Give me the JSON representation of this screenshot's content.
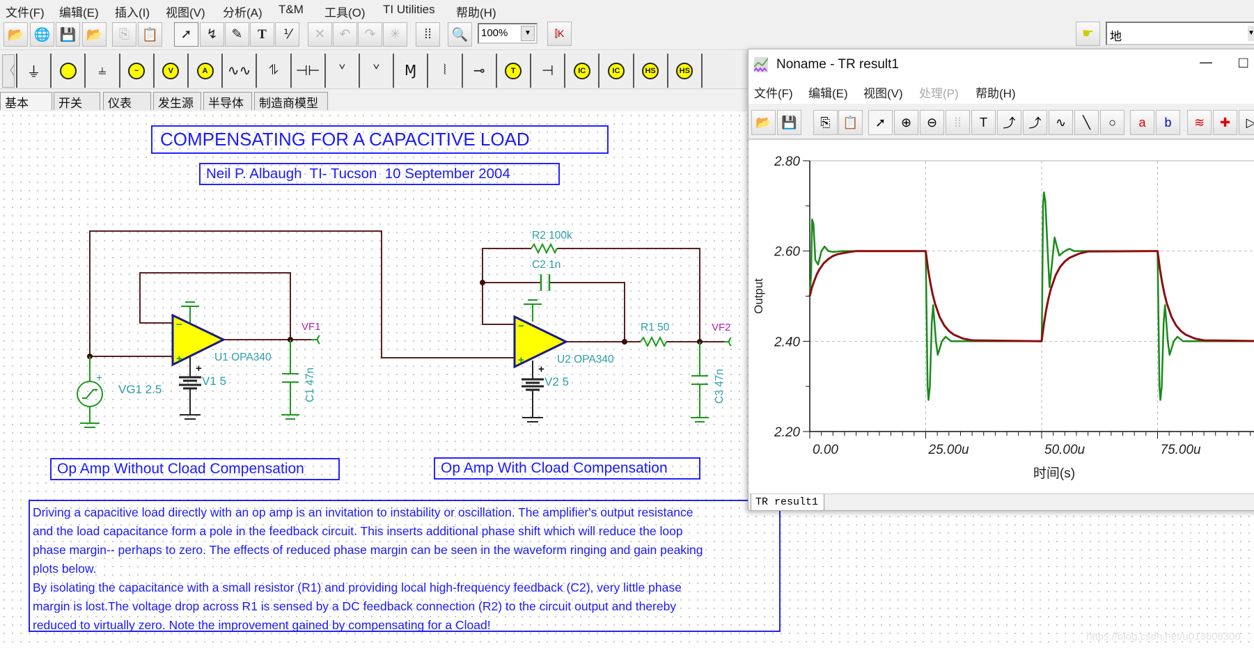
{
  "main_menu": [
    "文件(F)",
    "编辑(E)",
    "插入(I)",
    "视图(V)",
    "分析(A)",
    "T&M",
    "工具(O)",
    "TI Utilities",
    "帮助(H)"
  ],
  "toolbar": {
    "buttons": [
      {
        "icon": "open-folder-icon",
        "enabled": true
      },
      {
        "icon": "web-globe-icon",
        "enabled": true
      },
      {
        "icon": "save-disk-icon",
        "enabled": true
      },
      {
        "icon": "open-recent-icon",
        "enabled": true
      },
      {
        "icon": "copy-icon",
        "enabled": false
      },
      {
        "icon": "paste-icon",
        "enabled": true
      },
      {
        "icon": "pointer-arrow-icon",
        "enabled": true,
        "pressed": true
      },
      {
        "icon": "wire-icon",
        "enabled": true
      },
      {
        "icon": "pencil-icon",
        "enabled": true
      },
      {
        "icon": "text-t-icon",
        "enabled": true
      },
      {
        "icon": "wire-tool-icon",
        "enabled": true
      },
      {
        "icon": "delete-x-icon",
        "enabled": false
      },
      {
        "icon": "undo-icon",
        "enabled": false
      },
      {
        "icon": "redo-icon",
        "enabled": false
      },
      {
        "icon": "junction-icon",
        "enabled": false
      },
      {
        "icon": "grid-icon",
        "enabled": true
      },
      {
        "icon": "zoom-icon",
        "enabled": true
      }
    ],
    "zoom_value": "100%",
    "component_search_value": "地"
  },
  "component_bar": [
    "ground-icon",
    "current-source-icon",
    "battery-icon",
    "voltage-generator-icon",
    "voltmeter-icon",
    "ammeter-icon",
    "resistor-icon",
    "potentiometer-icon",
    "capacitor-icon",
    "inductor-icon",
    "variable-inductor-icon",
    "transformer-m-icon",
    "transformer-icon",
    "switch-icon",
    "thermistor-icon",
    "capacitor-polar-icon",
    "ic-current-icon",
    "ic-current-plus-icon",
    "hs-icon",
    "hs-plus-icon",
    "empty-slot"
  ],
  "component_tabs": [
    "基本",
    "开关",
    "仪表",
    "发生源",
    "半导体",
    "制造商模型"
  ],
  "schematic": {
    "title": "COMPENSATING FOR A CAPACITIVE LOAD",
    "subtitle": "Neil P. Albaugh  TI- Tucson  10 September 2004",
    "label_left": "Op Amp Without Cload Compensation",
    "label_right": "Op Amp With Cload Compensation",
    "components": {
      "u1": "U1 OPA340",
      "u2": "U2 OPA340",
      "v1": "V1 5",
      "v2": "V2 5",
      "vg1": "VG1 2.5",
      "c1": "C1 47n",
      "c2": "C2 1n",
      "c3": "C3 47n",
      "r1": "R1 50",
      "r2": "R2 100k",
      "vf1": "VF1",
      "vf2": "VF2",
      "plus": "+"
    },
    "description": [
      "Driving a capacitive load directly with an op amp is an invitation to instability or oscillation. The amplifier's output resistance",
      "and the load capacitance form a pole in the feedback circuit. This inserts additional phase shift which will reduce the loop",
      "phase margin-- perhaps to zero. The effects of reduced phase margin can be seen in the waveform ringing and gain peaking",
      "plots below.",
      "By isolating the capacitance with a small resistor (R1) and providing local high-frequency feedback (C2), very little phase",
      "margin is lost.The voltage drop across R1 is sensed by a DC feedback connection (R2) to the circuit output and thereby",
      "reduced to virtually zero. Note the improvement gained by compensating for a Cload!"
    ]
  },
  "result_window": {
    "title": "Noname - TR result1",
    "menu": [
      {
        "label": "文件(F)",
        "enabled": true
      },
      {
        "label": "编辑(E)",
        "enabled": true
      },
      {
        "label": "视图(V)",
        "enabled": true
      },
      {
        "label": "处理(P)",
        "enabled": false
      },
      {
        "label": "帮助(H)",
        "enabled": true
      }
    ],
    "toolbar": [
      "open-folder-icon",
      "save-disk-icon",
      "copy-icon",
      "paste-icon",
      "pointer-arrow-icon",
      "zoom-in-icon",
      "zoom-100-icon",
      "grid-icon",
      "text-t-icon",
      "annotate-text-icon",
      "annotate-question-icon",
      "formula-icon",
      "line-icon",
      "circle-icon",
      "cursor-a-icon",
      "cursor-b-icon",
      "add-curve-icon",
      "probe-icon",
      "triangle-icon"
    ],
    "tab": "TR result1",
    "minimize": "—",
    "maximize": "□"
  },
  "chart_data": {
    "type": "line",
    "title": "",
    "xlabel": "时间(s)",
    "ylabel": "Output",
    "xlim": [
      0,
      100
    ],
    "ylim": [
      2.2,
      2.8
    ],
    "x_unit": "us",
    "x_ticks": [
      {
        "v": 0,
        "label": "0.00"
      },
      {
        "v": 25,
        "label": "25.00u"
      },
      {
        "v": 50,
        "label": "50.00u"
      },
      {
        "v": 75,
        "label": "75.00u"
      }
    ],
    "y_ticks": [
      {
        "v": 2.2,
        "label": "2.20"
      },
      {
        "v": 2.4,
        "label": "2.40"
      },
      {
        "v": 2.6,
        "label": "2.60"
      },
      {
        "v": 2.8,
        "label": "2.80"
      }
    ],
    "grid": true,
    "series": [
      {
        "color": "#1a8a1a",
        "x": [
          0,
          0.3,
          0.5,
          0.8,
          1.2,
          1.8,
          2.5,
          3.2,
          4,
          5,
          7,
          25,
          25.1,
          25.4,
          25.6,
          25.9,
          26.3,
          26.6,
          27.2,
          27.6,
          28.5,
          29.3,
          30.5,
          35,
          50,
          50.1,
          50.3,
          50.5,
          50.8,
          51.3,
          51.7,
          52.2,
          52.8,
          53.8,
          55,
          56,
          57,
          75,
          75.1,
          75.4,
          75.6,
          75.9,
          76.3,
          76.6,
          77.2,
          77.6,
          78.5,
          79.3,
          80.5,
          100
        ],
        "y": [
          2.5,
          2.55,
          2.67,
          2.66,
          2.58,
          2.57,
          2.6,
          2.61,
          2.6,
          2.598,
          2.6,
          2.6,
          2.52,
          2.3,
          2.27,
          2.3,
          2.44,
          2.48,
          2.4,
          2.37,
          2.4,
          2.41,
          2.4,
          2.4,
          2.4,
          2.47,
          2.7,
          2.73,
          2.71,
          2.6,
          2.52,
          2.57,
          2.63,
          2.59,
          2.6,
          2.605,
          2.6,
          2.6,
          2.52,
          2.3,
          2.27,
          2.3,
          2.44,
          2.48,
          2.4,
          2.37,
          2.4,
          2.41,
          2.4,
          2.4
        ]
      },
      {
        "color": "#8b0f0f",
        "x": [
          0,
          0.5,
          1,
          1.5,
          2,
          3,
          4,
          5,
          6,
          8,
          10,
          25,
          25.5,
          26,
          26.5,
          27,
          28,
          29,
          30,
          31,
          33,
          35,
          50,
          50.5,
          51,
          51.5,
          52,
          53,
          54,
          55,
          56,
          58,
          60,
          75,
          75.5,
          76,
          76.5,
          77,
          78,
          79,
          80,
          81,
          83,
          85,
          100
        ],
        "y": [
          2.5,
          2.52,
          2.535,
          2.548,
          2.558,
          2.573,
          2.582,
          2.589,
          2.593,
          2.597,
          2.6,
          2.6,
          2.561,
          2.529,
          2.504,
          2.484,
          2.454,
          2.435,
          2.423,
          2.415,
          2.406,
          2.402,
          2.4,
          2.439,
          2.471,
          2.496,
          2.516,
          2.546,
          2.565,
          2.577,
          2.585,
          2.594,
          2.599,
          2.6,
          2.561,
          2.529,
          2.504,
          2.484,
          2.454,
          2.435,
          2.423,
          2.415,
          2.406,
          2.402,
          2.4
        ]
      }
    ]
  },
  "watermark": "https://blog.csdn.net/u013608300"
}
